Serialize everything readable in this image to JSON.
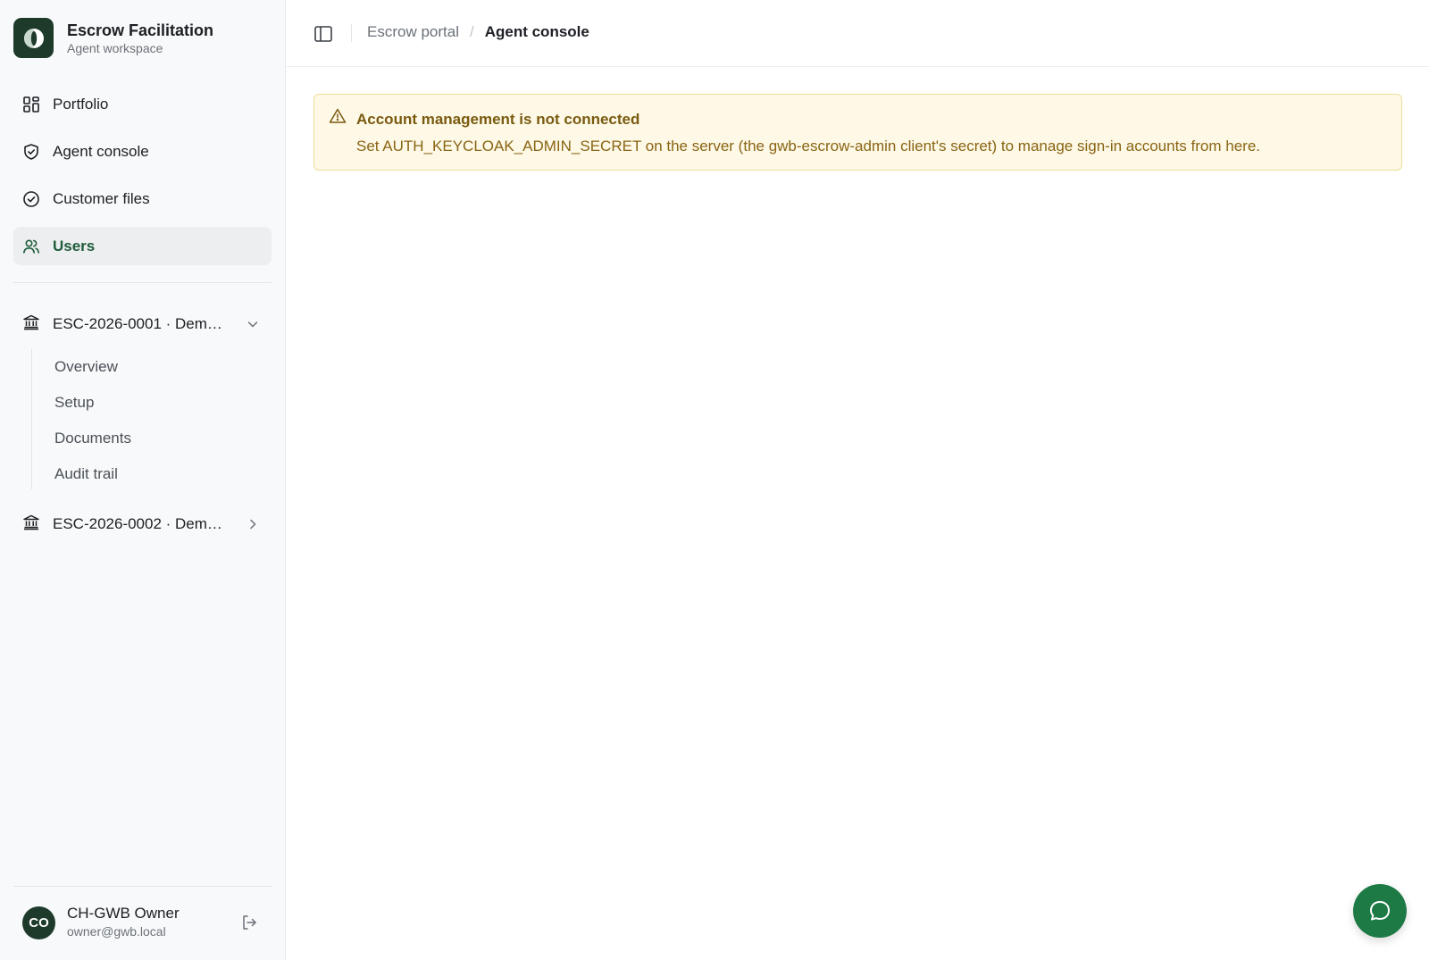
{
  "brand": {
    "title": "Escrow Facilitation",
    "subtitle": "Agent workspace"
  },
  "nav": {
    "items": [
      {
        "label": "Portfolio",
        "icon": "grid-icon"
      },
      {
        "label": "Agent console",
        "icon": "shield-icon"
      },
      {
        "label": "Customer files",
        "icon": "check-circle-icon"
      },
      {
        "label": "Users",
        "icon": "users-icon",
        "active": true
      }
    ]
  },
  "escrows": [
    {
      "label": "ESC-2026-0001 · Dem…",
      "expanded": true,
      "children": [
        "Overview",
        "Setup",
        "Documents",
        "Audit trail"
      ]
    },
    {
      "label": "ESC-2026-0002 · Dem…",
      "expanded": false
    }
  ],
  "user": {
    "initials": "CO",
    "name": "CH-GWB Owner",
    "email": "owner@gwb.local"
  },
  "breadcrumb": {
    "parent": "Escrow portal",
    "current": "Agent console"
  },
  "alert": {
    "title": "Account management is not connected",
    "body": "Set AUTH_KEYCLOAK_ADMIN_SECRET on the server (the gwb-escrow-admin client's secret) to manage sign-in accounts from here."
  },
  "colors": {
    "brand_dark": "#1e3a2b",
    "accent_green": "#1d7a45",
    "active_text": "#1e5c3a",
    "alert_bg": "#fdf9e6",
    "alert_border": "#eedc9a",
    "alert_text": "#8a6414"
  }
}
